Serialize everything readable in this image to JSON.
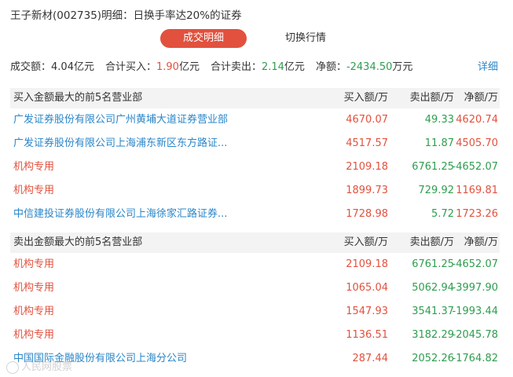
{
  "title": "王子新材(002735)明细：日换手率达20%的证券",
  "tabs": {
    "active": "成交明细",
    "other": "切换行情"
  },
  "summary": {
    "turnover_label": "成交额：",
    "turnover_value": "4.04亿元",
    "total_buy_label": "合计买入：",
    "total_buy_value": "1.90",
    "total_buy_unit": "亿元",
    "total_sell_label": "合计卖出：",
    "total_sell_value": "2.14",
    "total_sell_unit": "亿元",
    "net_label": "净额：",
    "net_value": "-2434.50",
    "net_unit": "万元",
    "detail_link": "详细"
  },
  "buy_section": {
    "header": "买入金额最大的前5名营业部",
    "col_buy": "买入额/万",
    "col_sell": "卖出额/万",
    "col_net": "净额/万",
    "rows": [
      {
        "name": "广发证券股份有限公司广州黄埔大道证券营业部",
        "buy": "4670.07",
        "sell": "49.33",
        "net": "4620.74",
        "link": true
      },
      {
        "name": "广发证券股份有限公司上海浦东新区东方路证...",
        "buy": "4517.57",
        "sell": "11.87",
        "net": "4505.70",
        "link": true
      },
      {
        "name": "机构专用",
        "buy": "2109.18",
        "sell": "6761.25",
        "net": "-4652.07",
        "link": false
      },
      {
        "name": "机构专用",
        "buy": "1899.73",
        "sell": "729.92",
        "net": "1169.81",
        "link": false
      },
      {
        "name": "中信建投证券股份有限公司上海徐家汇路证券...",
        "buy": "1728.98",
        "sell": "5.72",
        "net": "1723.26",
        "link": true
      }
    ]
  },
  "sell_section": {
    "header": "卖出金额最大的前5名营业部",
    "col_buy": "买入额/万",
    "col_sell": "卖出额/万",
    "col_net": "净额/万",
    "rows": [
      {
        "name": "机构专用",
        "buy": "2109.18",
        "sell": "6761.25",
        "net": "-4652.07",
        "link": false
      },
      {
        "name": "机构专用",
        "buy": "1065.04",
        "sell": "5062.94",
        "net": "-3997.90",
        "link": false
      },
      {
        "name": "机构专用",
        "buy": "1547.93",
        "sell": "3541.37",
        "net": "-1993.44",
        "link": false
      },
      {
        "name": "机构专用",
        "buy": "1136.51",
        "sell": "3182.29",
        "net": "-2045.78",
        "link": false
      },
      {
        "name": "中国国际金融股份有限公司上海分公司",
        "buy": "287.44",
        "sell": "2052.26",
        "net": "-1764.82",
        "link": true
      }
    ]
  },
  "watermark": "人民网股票",
  "colors": {
    "red": "#e2513e",
    "green": "#2e9e4f",
    "blue": "#2a86c8",
    "header_bg": "#f3f3f3"
  }
}
